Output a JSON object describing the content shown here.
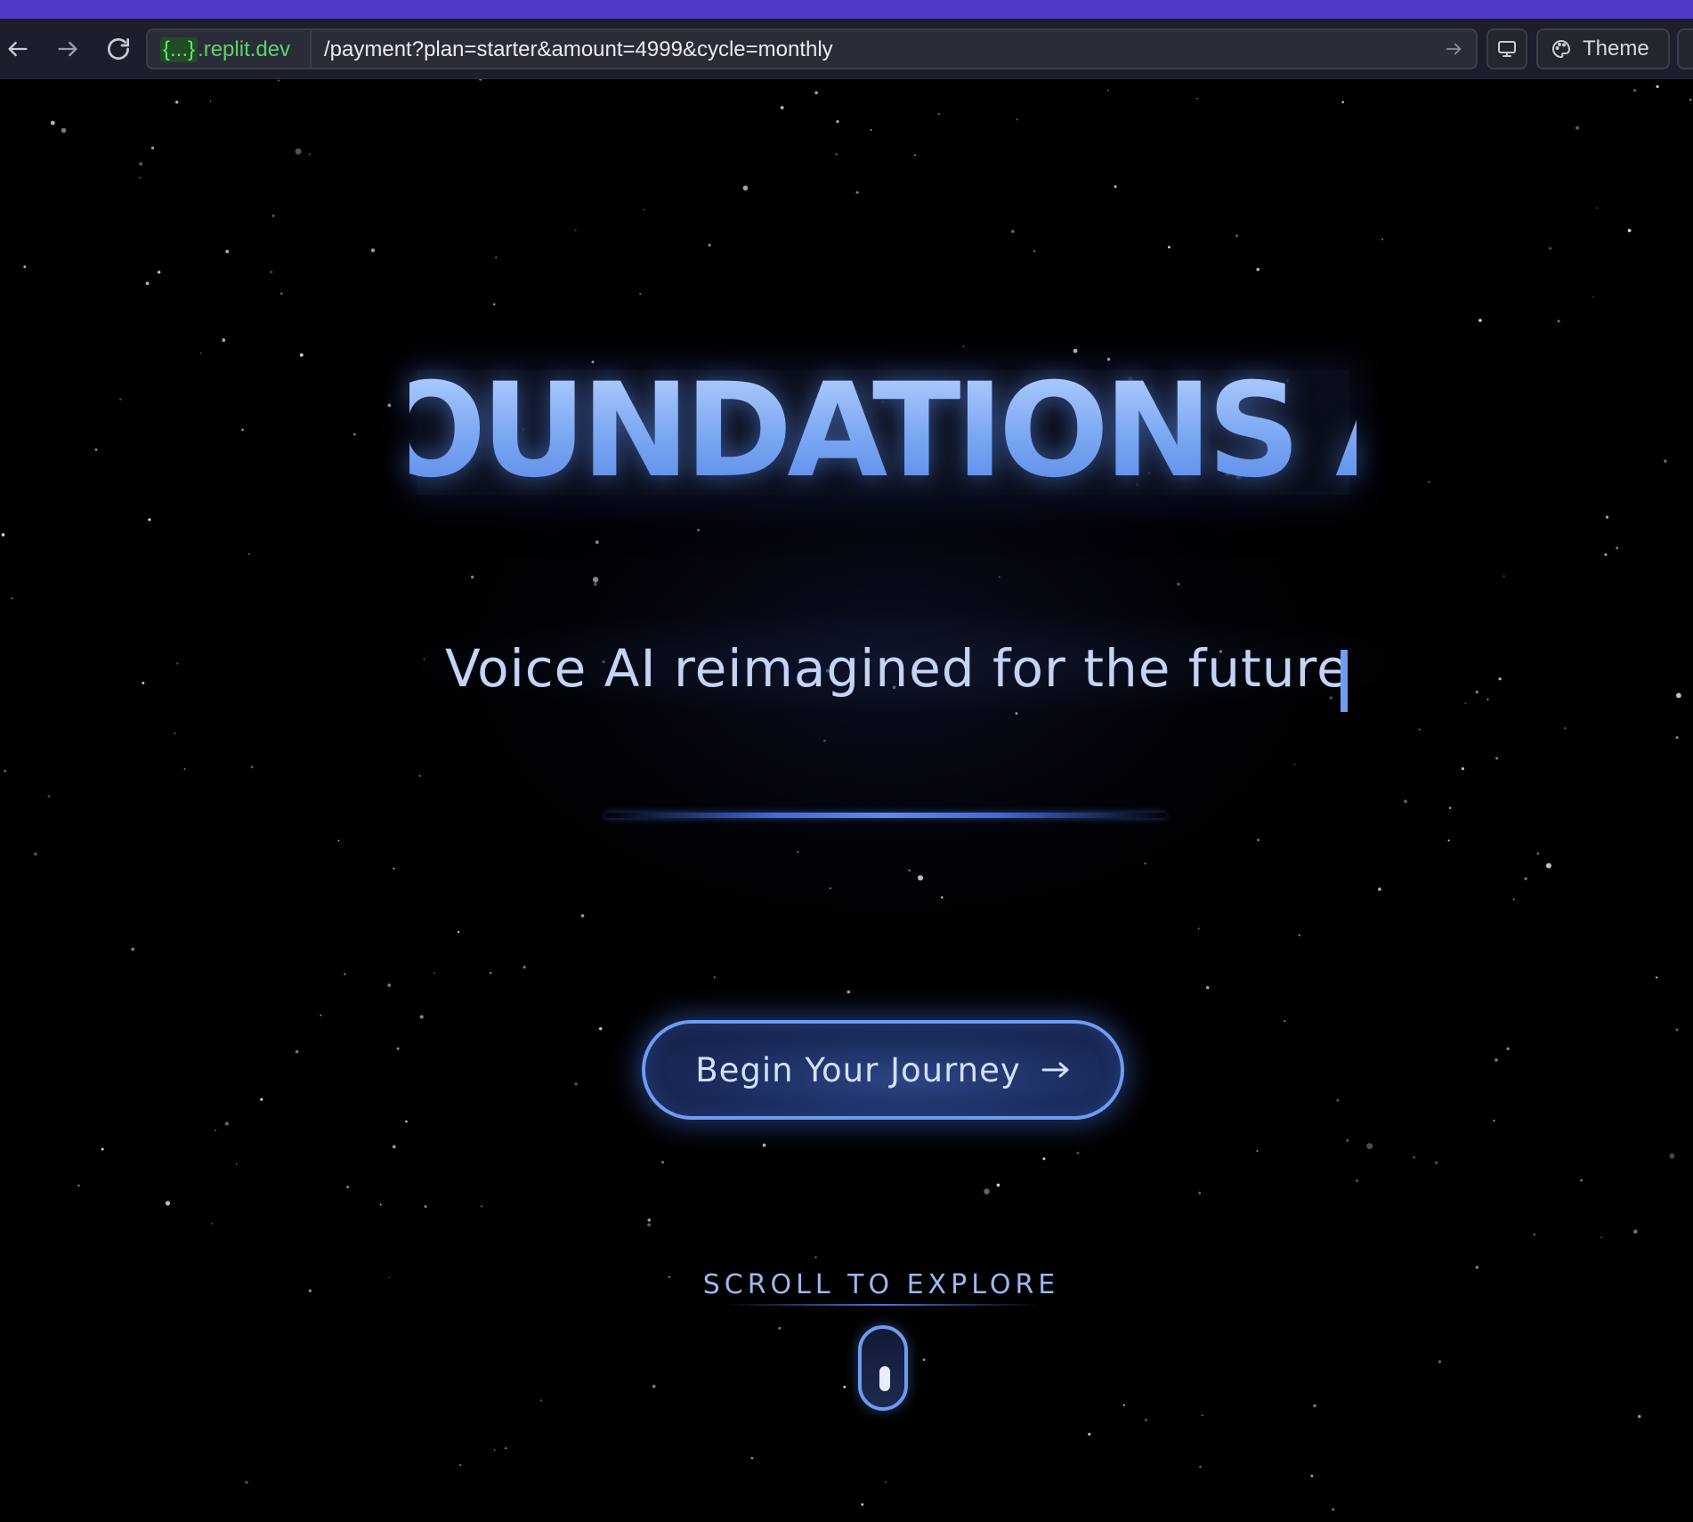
{
  "browser": {
    "url_host_prefix": "{...}",
    "url_host_domain": ".replit.dev",
    "url_path": "/payment?plan=starter&amount=4999&cycle=monthly",
    "theme_label": "Theme",
    "icons": {
      "back": "arrow-left-icon",
      "forward": "arrow-right-icon",
      "reload": "reload-icon",
      "go": "arrow-right-icon",
      "device": "monitor-icon",
      "theme": "palette-icon"
    }
  },
  "hero": {
    "title": "FOUNDATIONS AI",
    "subtitle": "Voice AI reimagined for the future",
    "cta_label": "Begin Your Journey",
    "scroll_label": "SCROLL TO EXPLORE"
  },
  "colors": {
    "accent": "#6e9cf2",
    "title_top": "#b4d0ff",
    "title_bottom": "#5a89e6",
    "browser_strip": "#4f3bc8",
    "url_host": "#5fd36a",
    "background": "#000000"
  }
}
